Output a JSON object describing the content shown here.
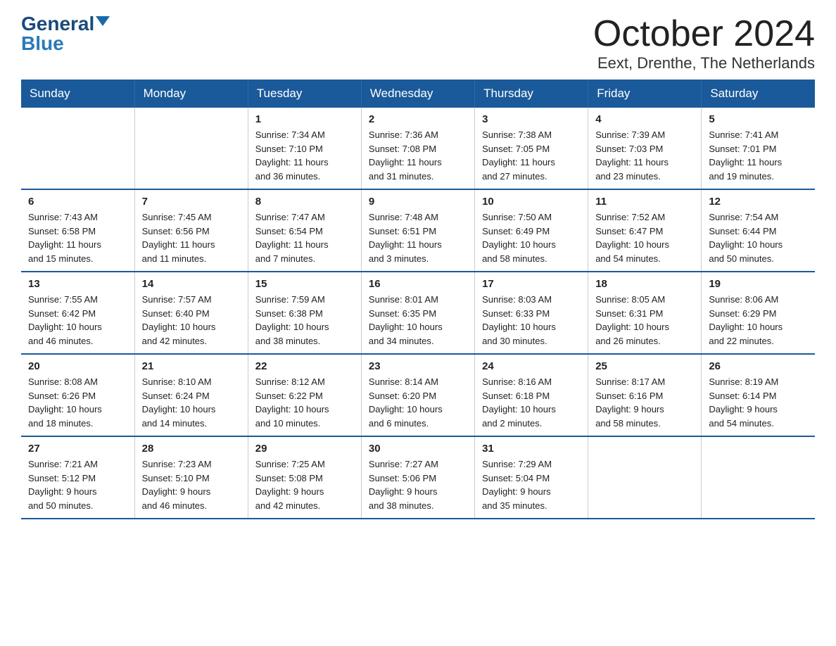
{
  "logo": {
    "general": "General",
    "blue": "Blue"
  },
  "header": {
    "month": "October 2024",
    "location": "Eext, Drenthe, The Netherlands"
  },
  "days_of_week": [
    "Sunday",
    "Monday",
    "Tuesday",
    "Wednesday",
    "Thursday",
    "Friday",
    "Saturday"
  ],
  "weeks": [
    [
      {
        "day": "",
        "info": ""
      },
      {
        "day": "",
        "info": ""
      },
      {
        "day": "1",
        "info": "Sunrise: 7:34 AM\nSunset: 7:10 PM\nDaylight: 11 hours\nand 36 minutes."
      },
      {
        "day": "2",
        "info": "Sunrise: 7:36 AM\nSunset: 7:08 PM\nDaylight: 11 hours\nand 31 minutes."
      },
      {
        "day": "3",
        "info": "Sunrise: 7:38 AM\nSunset: 7:05 PM\nDaylight: 11 hours\nand 27 minutes."
      },
      {
        "day": "4",
        "info": "Sunrise: 7:39 AM\nSunset: 7:03 PM\nDaylight: 11 hours\nand 23 minutes."
      },
      {
        "day": "5",
        "info": "Sunrise: 7:41 AM\nSunset: 7:01 PM\nDaylight: 11 hours\nand 19 minutes."
      }
    ],
    [
      {
        "day": "6",
        "info": "Sunrise: 7:43 AM\nSunset: 6:58 PM\nDaylight: 11 hours\nand 15 minutes."
      },
      {
        "day": "7",
        "info": "Sunrise: 7:45 AM\nSunset: 6:56 PM\nDaylight: 11 hours\nand 11 minutes."
      },
      {
        "day": "8",
        "info": "Sunrise: 7:47 AM\nSunset: 6:54 PM\nDaylight: 11 hours\nand 7 minutes."
      },
      {
        "day": "9",
        "info": "Sunrise: 7:48 AM\nSunset: 6:51 PM\nDaylight: 11 hours\nand 3 minutes."
      },
      {
        "day": "10",
        "info": "Sunrise: 7:50 AM\nSunset: 6:49 PM\nDaylight: 10 hours\nand 58 minutes."
      },
      {
        "day": "11",
        "info": "Sunrise: 7:52 AM\nSunset: 6:47 PM\nDaylight: 10 hours\nand 54 minutes."
      },
      {
        "day": "12",
        "info": "Sunrise: 7:54 AM\nSunset: 6:44 PM\nDaylight: 10 hours\nand 50 minutes."
      }
    ],
    [
      {
        "day": "13",
        "info": "Sunrise: 7:55 AM\nSunset: 6:42 PM\nDaylight: 10 hours\nand 46 minutes."
      },
      {
        "day": "14",
        "info": "Sunrise: 7:57 AM\nSunset: 6:40 PM\nDaylight: 10 hours\nand 42 minutes."
      },
      {
        "day": "15",
        "info": "Sunrise: 7:59 AM\nSunset: 6:38 PM\nDaylight: 10 hours\nand 38 minutes."
      },
      {
        "day": "16",
        "info": "Sunrise: 8:01 AM\nSunset: 6:35 PM\nDaylight: 10 hours\nand 34 minutes."
      },
      {
        "day": "17",
        "info": "Sunrise: 8:03 AM\nSunset: 6:33 PM\nDaylight: 10 hours\nand 30 minutes."
      },
      {
        "day": "18",
        "info": "Sunrise: 8:05 AM\nSunset: 6:31 PM\nDaylight: 10 hours\nand 26 minutes."
      },
      {
        "day": "19",
        "info": "Sunrise: 8:06 AM\nSunset: 6:29 PM\nDaylight: 10 hours\nand 22 minutes."
      }
    ],
    [
      {
        "day": "20",
        "info": "Sunrise: 8:08 AM\nSunset: 6:26 PM\nDaylight: 10 hours\nand 18 minutes."
      },
      {
        "day": "21",
        "info": "Sunrise: 8:10 AM\nSunset: 6:24 PM\nDaylight: 10 hours\nand 14 minutes."
      },
      {
        "day": "22",
        "info": "Sunrise: 8:12 AM\nSunset: 6:22 PM\nDaylight: 10 hours\nand 10 minutes."
      },
      {
        "day": "23",
        "info": "Sunrise: 8:14 AM\nSunset: 6:20 PM\nDaylight: 10 hours\nand 6 minutes."
      },
      {
        "day": "24",
        "info": "Sunrise: 8:16 AM\nSunset: 6:18 PM\nDaylight: 10 hours\nand 2 minutes."
      },
      {
        "day": "25",
        "info": "Sunrise: 8:17 AM\nSunset: 6:16 PM\nDaylight: 9 hours\nand 58 minutes."
      },
      {
        "day": "26",
        "info": "Sunrise: 8:19 AM\nSunset: 6:14 PM\nDaylight: 9 hours\nand 54 minutes."
      }
    ],
    [
      {
        "day": "27",
        "info": "Sunrise: 7:21 AM\nSunset: 5:12 PM\nDaylight: 9 hours\nand 50 minutes."
      },
      {
        "day": "28",
        "info": "Sunrise: 7:23 AM\nSunset: 5:10 PM\nDaylight: 9 hours\nand 46 minutes."
      },
      {
        "day": "29",
        "info": "Sunrise: 7:25 AM\nSunset: 5:08 PM\nDaylight: 9 hours\nand 42 minutes."
      },
      {
        "day": "30",
        "info": "Sunrise: 7:27 AM\nSunset: 5:06 PM\nDaylight: 9 hours\nand 38 minutes."
      },
      {
        "day": "31",
        "info": "Sunrise: 7:29 AM\nSunset: 5:04 PM\nDaylight: 9 hours\nand 35 minutes."
      },
      {
        "day": "",
        "info": ""
      },
      {
        "day": "",
        "info": ""
      }
    ]
  ]
}
